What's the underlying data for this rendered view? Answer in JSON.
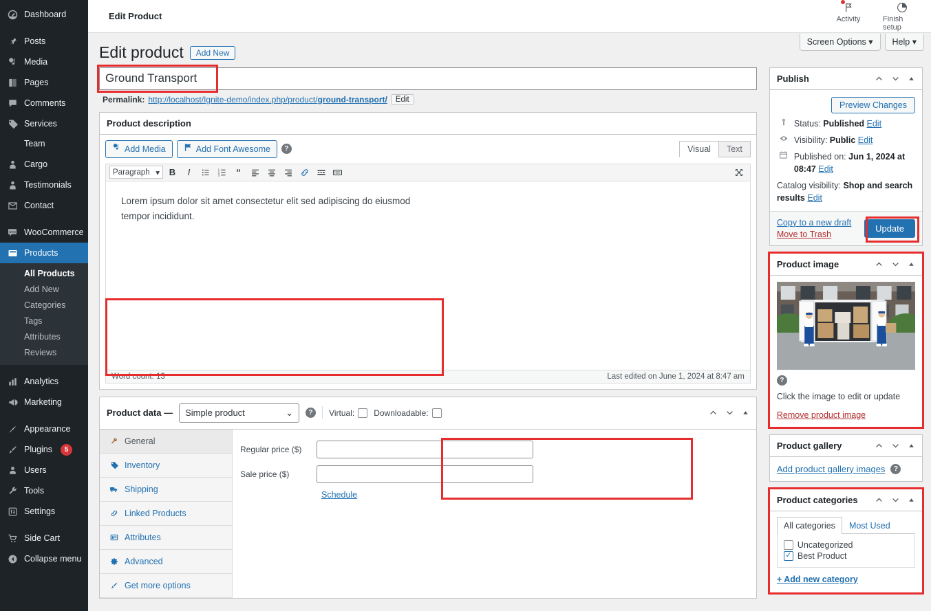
{
  "sidebar": {
    "items": [
      {
        "label": "Dashboard",
        "icon": "dashboard-icon",
        "type": "item"
      },
      {
        "label": "Posts",
        "icon": "pin-icon",
        "type": "item"
      },
      {
        "label": "Media",
        "icon": "media-icon",
        "type": "item"
      },
      {
        "label": "Pages",
        "icon": "pages-icon",
        "type": "item"
      },
      {
        "label": "Comments",
        "icon": "comments-icon",
        "type": "item"
      },
      {
        "label": "Services",
        "icon": "tag-icon",
        "type": "item"
      },
      {
        "label": "Team",
        "icon": "none",
        "type": "noicon"
      },
      {
        "label": "Cargo",
        "icon": "person-icon",
        "type": "item"
      },
      {
        "label": "Testimonials",
        "icon": "person-icon",
        "type": "item"
      },
      {
        "label": "Contact",
        "icon": "mail-icon",
        "type": "item"
      },
      {
        "label": "WooCommerce",
        "icon": "woo-icon",
        "type": "item"
      },
      {
        "label": "Products",
        "icon": "products-icon",
        "type": "active"
      }
    ],
    "submenu": [
      {
        "label": "All Products",
        "current": true
      },
      {
        "label": "Add New",
        "current": false
      },
      {
        "label": "Categories",
        "current": false
      },
      {
        "label": "Tags",
        "current": false
      },
      {
        "label": "Attributes",
        "current": false
      },
      {
        "label": "Reviews",
        "current": false
      }
    ],
    "items_after": [
      {
        "label": "Analytics",
        "icon": "analytics-icon",
        "type": "item"
      },
      {
        "label": "Marketing",
        "icon": "megaphone-icon",
        "type": "item"
      },
      {
        "label": "Appearance",
        "icon": "brush-icon",
        "type": "item"
      },
      {
        "label": "Plugins",
        "icon": "plugin-icon",
        "type": "item",
        "badge": "5"
      },
      {
        "label": "Users",
        "icon": "users-icon",
        "type": "item"
      },
      {
        "label": "Tools",
        "icon": "wrench-icon",
        "type": "item"
      },
      {
        "label": "Settings",
        "icon": "settings-icon",
        "type": "item"
      },
      {
        "label": "Side Cart",
        "icon": "cart-icon",
        "type": "item"
      },
      {
        "label": "Collapse menu",
        "icon": "collapse-icon",
        "type": "item"
      }
    ]
  },
  "topbar": {
    "title": "Edit Product",
    "activity_label": "Activity",
    "finish_setup_label": "Finish setup",
    "screen_options_label": "Screen Options",
    "help_label": "Help"
  },
  "page": {
    "heading": "Edit product",
    "add_new_label": "Add New",
    "product_title": "Ground Transport",
    "permalink_prefix": "Permalink:",
    "permalink_base": "http://localhost/Ignite-demo/index.php/product/",
    "permalink_slug": "ground-transport/",
    "permalink_edit_label": "Edit"
  },
  "editor": {
    "panel_title": "Product description",
    "add_media_label": "Add Media",
    "add_font_awesome_label": "Add Font Awesome",
    "help_icon": "help-icon",
    "tab_visual": "Visual",
    "tab_text": "Text",
    "format_select": "Paragraph",
    "toolbar_icons": [
      "bold-icon",
      "italic-icon",
      "bulleted-list-icon",
      "numbered-list-icon",
      "blockquote-icon",
      "align-left-icon",
      "align-center-icon",
      "align-right-icon",
      "link-icon",
      "read-more-icon",
      "keyboard-shortcuts-icon"
    ],
    "fullscreen_icon": "fullscreen-icon",
    "body_text": "Lorem ipsum dolor sit amet consectetur elit sed adipiscing do eiusmod tempor incididunt.",
    "word_count": "Word count: 13",
    "last_edited": "Last edited on June 1, 2024 at 8:47 am"
  },
  "product_data": {
    "label": "Product data —",
    "type_selected": "Simple product",
    "virtual_label": "Virtual:",
    "downloadable_label": "Downloadable:",
    "virtual_checked": false,
    "downloadable_checked": false,
    "tabs": [
      {
        "label": "General",
        "icon": "wrench-icon",
        "active": true
      },
      {
        "label": "Inventory",
        "icon": "tag-icon",
        "active": false
      },
      {
        "label": "Shipping",
        "icon": "truck-icon",
        "active": false
      },
      {
        "label": "Linked Products",
        "icon": "link-icon",
        "active": false
      },
      {
        "label": "Attributes",
        "icon": "list-icon",
        "active": false
      },
      {
        "label": "Advanced",
        "icon": "gear-icon",
        "active": false
      },
      {
        "label": "Get more options",
        "icon": "extension-icon",
        "active": false
      }
    ],
    "regular_price_label": "Regular price ($)",
    "regular_price_value": "",
    "sale_price_label": "Sale price ($)",
    "sale_price_value": "",
    "schedule_label": "Schedule"
  },
  "publish": {
    "title": "Publish",
    "preview_label": "Preview Changes",
    "status_label": "Status:",
    "status_value": "Published",
    "status_edit": "Edit",
    "visibility_label": "Visibility:",
    "visibility_value": "Public",
    "visibility_edit": "Edit",
    "published_label": "Published on:",
    "published_value": "Jun 1, 2024 at 08:47",
    "published_edit": "Edit",
    "catalog_label": "Catalog visibility:",
    "catalog_value": "Shop and search results",
    "catalog_edit": "Edit",
    "copy_draft_label": "Copy to a new draft",
    "move_trash_label": "Move to Trash",
    "update_label": "Update"
  },
  "product_image": {
    "title": "Product image",
    "help_icon": "help-icon",
    "caption": "Click the image to edit or update",
    "remove_label": "Remove product image"
  },
  "product_gallery": {
    "title": "Product gallery",
    "add_label": "Add product gallery images"
  },
  "product_categories": {
    "title": "Product categories",
    "tab_all": "All categories",
    "tab_most_used": "Most Used",
    "items": [
      {
        "label": "Uncategorized",
        "checked": false
      },
      {
        "label": "Best Product",
        "checked": true
      }
    ],
    "add_new_label": "+ Add new category"
  },
  "colors": {
    "accent": "#2271b1",
    "sidebar_bg": "#1d2327",
    "highlight": "#e62c2c",
    "danger": "#b32d2e",
    "badge": "#d63638"
  }
}
